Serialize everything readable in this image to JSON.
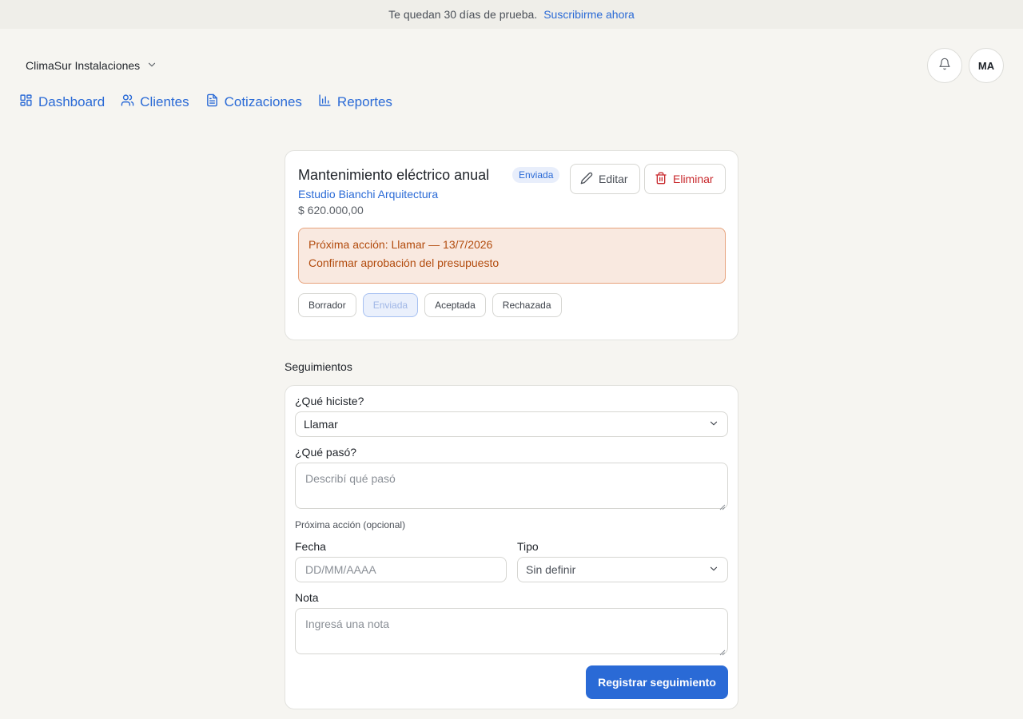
{
  "banner": {
    "text": "Te quedan 30 días de prueba.",
    "link": "Suscribirme ahora"
  },
  "header": {
    "org_name": "ClimaSur Instalaciones",
    "avatar_initials": "MA"
  },
  "nav": {
    "items": [
      {
        "label": "Dashboard",
        "icon": "dashboard-icon"
      },
      {
        "label": "Clientes",
        "icon": "users-icon"
      },
      {
        "label": "Cotizaciones",
        "icon": "document-icon"
      },
      {
        "label": "Reportes",
        "icon": "bar-chart-icon"
      }
    ]
  },
  "quote": {
    "title": "Mantenimiento eléctrico anual",
    "status": "Enviada",
    "client": "Estudio Bianchi Arquitectura",
    "amount": "$ 620.000,00",
    "edit_label": "Editar",
    "delete_label": "Eliminar",
    "next_action_title": "Próxima acción: Llamar — 13/7/2026",
    "next_action_note": "Confirmar aprobación del presupuesto",
    "status_options": [
      "Borrador",
      "Enviada",
      "Aceptada",
      "Rechazada"
    ],
    "current_status_index": 1
  },
  "followups": {
    "section_title": "Seguimientos",
    "what_label": "¿Qué hiciste?",
    "what_value": "Llamar",
    "happened_label": "¿Qué pasó?",
    "happened_placeholder": "Describí qué pasó",
    "next_action_label": "Próxima acción (opcional)",
    "date_label": "Fecha",
    "date_placeholder": "DD/MM/AAAA",
    "type_label": "Tipo",
    "type_value": "Sin definir",
    "note_label": "Nota",
    "note_placeholder": "Ingresá una nota",
    "submit_label": "Registrar seguimiento"
  }
}
